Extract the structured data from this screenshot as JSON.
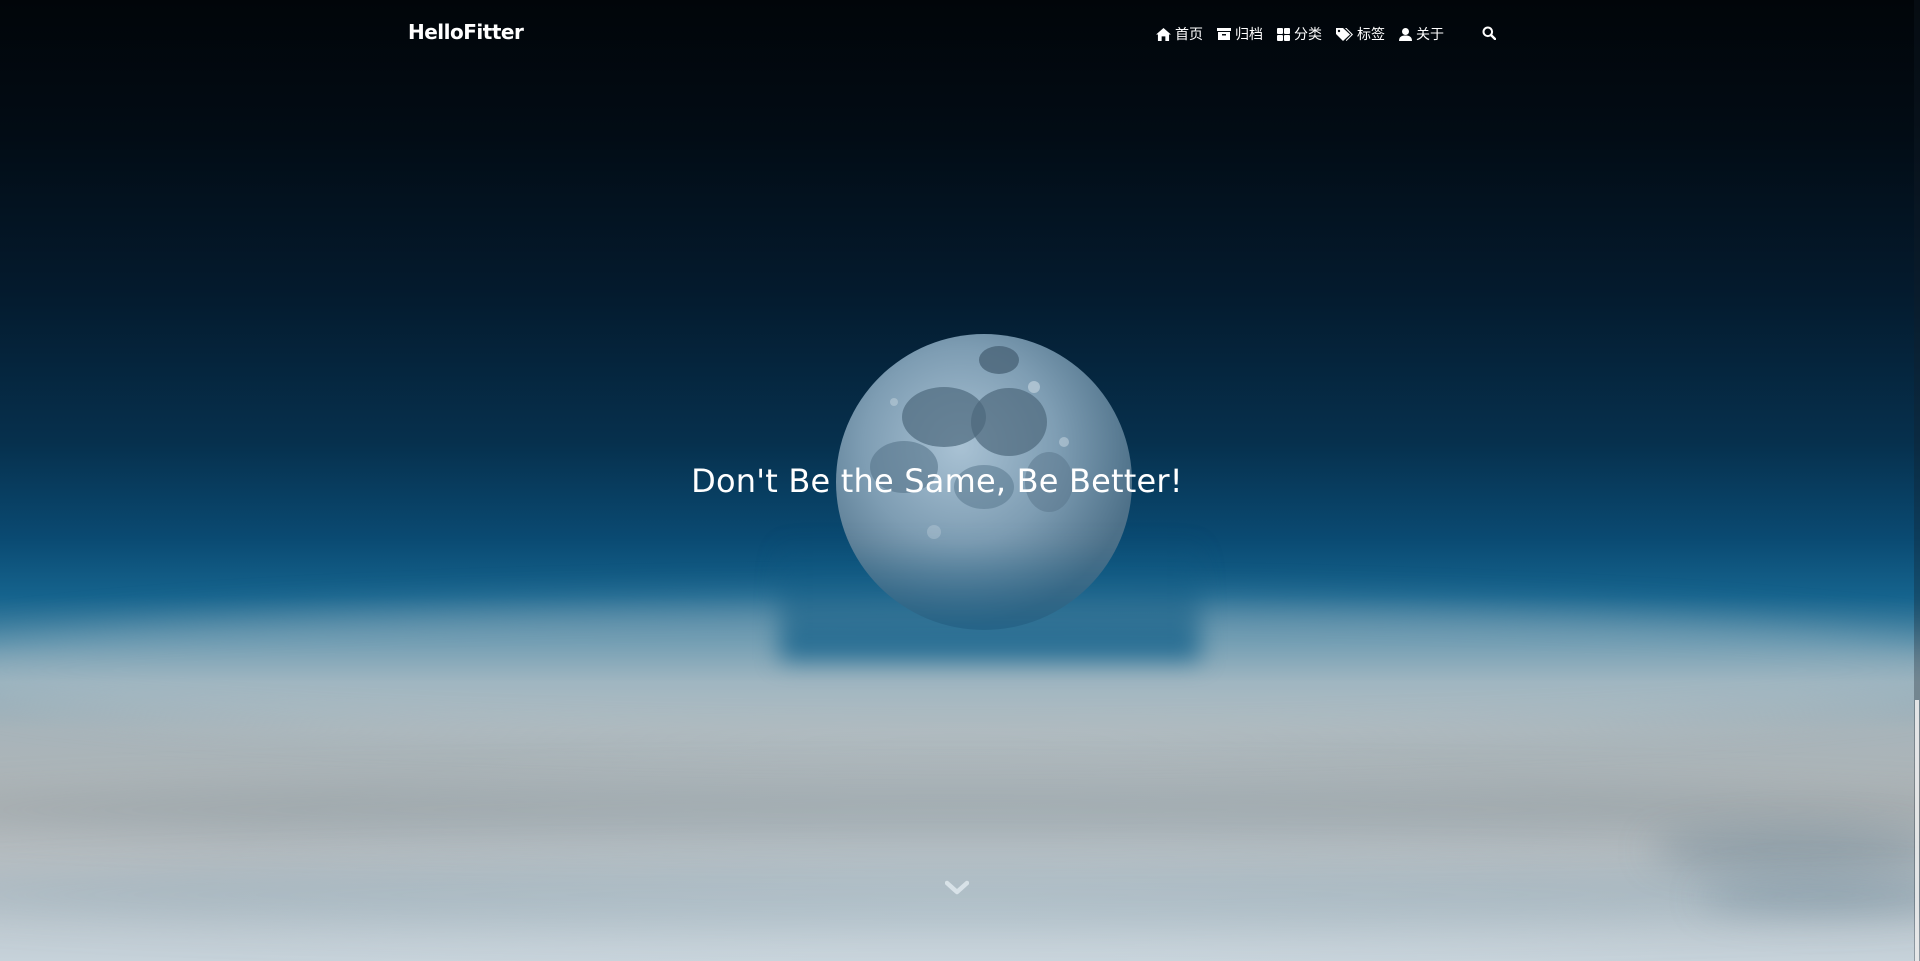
{
  "navbar": {
    "brand": "HelloFitter",
    "items": [
      {
        "icon": "home-icon",
        "label": "首页"
      },
      {
        "icon": "archive-icon",
        "label": "归档"
      },
      {
        "icon": "grid-icon",
        "label": "分类"
      },
      {
        "icon": "tags-icon",
        "label": "标签"
      },
      {
        "icon": "user-icon",
        "label": "关于"
      }
    ],
    "search_icon": "search-icon"
  },
  "hero": {
    "slogan": "Don't Be the Same, Be Better!",
    "scroll_icon": "chevron-down-icon"
  },
  "colors": {
    "text": "#ffffff",
    "sky_top": "#010509",
    "sky_horizon": "#15638d",
    "clouds": "#b2b6b7"
  }
}
